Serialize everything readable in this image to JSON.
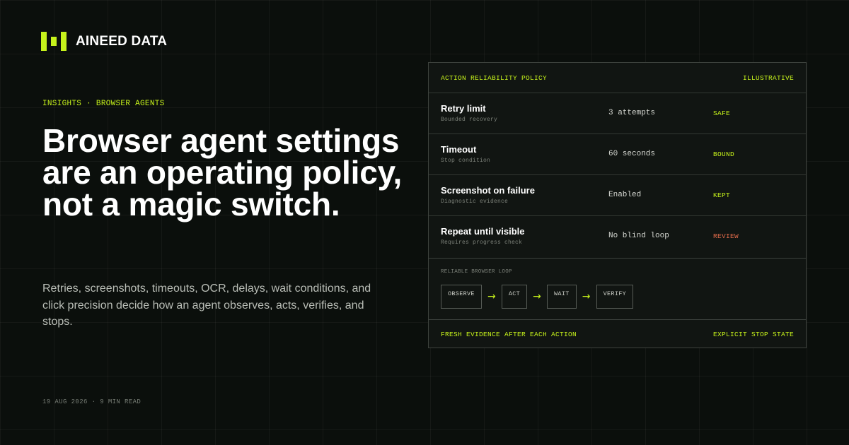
{
  "brand": {
    "name": "AINEED DATA",
    "accent": "#c6f21b",
    "warning": "#e06a4a"
  },
  "article": {
    "kicker": "INSIGHTS · BROWSER AGENTS",
    "title": "Browser agent settings are an operating policy, not a magic switch.",
    "dek": "Retries, screenshots, timeouts, OCR, delays, wait conditions, and click precision decide how an agent observes, acts, verifies, and stops.",
    "meta": "19 AUG 2026 · 9 MIN READ"
  },
  "panel": {
    "title": "ACTION RELIABILITY POLICY",
    "tag": "ILLUSTRATIVE",
    "rows": [
      {
        "name": "Retry limit",
        "sub": "Bounded recovery",
        "value": "3 attempts",
        "status": "SAFE",
        "status_color": "#c6f21b"
      },
      {
        "name": "Timeout",
        "sub": "Stop condition",
        "value": "60 seconds",
        "status": "BOUND",
        "status_color": "#c6f21b"
      },
      {
        "name": "Screenshot on failure",
        "sub": "Diagnostic evidence",
        "value": "Enabled",
        "status": "KEPT",
        "status_color": "#c6f21b"
      },
      {
        "name": "Repeat until visible",
        "sub": "Requires progress check",
        "value": "No blind loop",
        "status": "REVIEW",
        "status_color": "#e06a4a"
      }
    ],
    "loop": {
      "title": "RELIABLE BROWSER LOOP",
      "steps": [
        "OBSERVE",
        "ACT",
        "WAIT",
        "VERIFY"
      ],
      "arrow_icon": "arrow-right-icon"
    },
    "footer_left": "FRESH EVIDENCE AFTER EACH ACTION",
    "footer_right": "EXPLICIT STOP STATE"
  }
}
